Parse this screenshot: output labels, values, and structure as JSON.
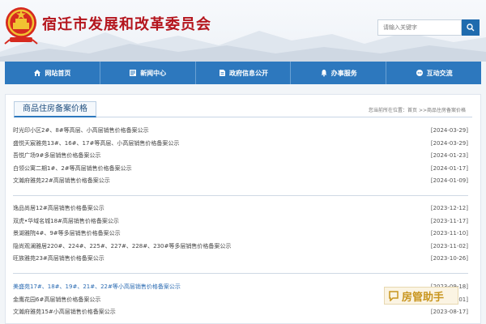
{
  "header": {
    "site_title": "宿迁市发展和改革委员会",
    "search_placeholder": "请输入关键字"
  },
  "nav": {
    "items": [
      {
        "label": "网站首页",
        "icon": "home-icon"
      },
      {
        "label": "新闻中心",
        "icon": "news-icon"
      },
      {
        "label": "政府信息公开",
        "icon": "document-icon"
      },
      {
        "label": "办事服务",
        "icon": "bell-icon"
      },
      {
        "label": "互动交流",
        "icon": "chat-icon"
      }
    ]
  },
  "section": {
    "title": "商品住房备案价格",
    "breadcrumb": "您当前所在位置：首页 >>商品住房备案价格"
  },
  "groups": [
    [
      {
        "title": "时光印小区2#、8#等高层、小高层销售价格备案公示",
        "date": "[2024-03-29]"
      },
      {
        "title": "盛悦天宸雅苑13#、16#、17#等高层、小高层销售价格备案公示",
        "date": "[2024-03-29]"
      },
      {
        "title": "吾悦广场9#多层销售价格备案公示",
        "date": "[2024-01-23]"
      },
      {
        "title": "白领公寓二期1#、2#等高层销售价格备案公示",
        "date": "[2024-01-17]"
      },
      {
        "title": "文瀚府雅苑22#高层销售价格备案公示",
        "date": "[2024-01-09]"
      }
    ],
    [
      {
        "title": "逸品尚居12#高层销售价格备案公示",
        "date": "[2023-12-12]"
      },
      {
        "title": "双虎•华域名城18#高层销售价格备案公示",
        "date": "[2023-11-17]"
      },
      {
        "title": "景湖雅院4#、9#等多层销售价格备案公示",
        "date": "[2023-11-10]"
      },
      {
        "title": "隐尚观澜雅居220#、224#、225#、227#、228#、230#等多层销售价格备案公示",
        "date": "[2023-11-02]"
      },
      {
        "title": "旺族雅苑23#高层销售价格备案公示",
        "date": "[2023-10-26]"
      }
    ],
    [
      {
        "title": "美盛苑17#、18#、19#、21#、22#等小高层销售价格备案公示",
        "date": "[2023-09-18]"
      },
      {
        "title": "金鹰花园6#高层销售价格备案公示",
        "date": "[2023-09-01]"
      },
      {
        "title": "文瀚府雅苑15#小高层销售价格备案公示",
        "date": "[2023-08-17]"
      }
    ]
  ],
  "watermark": {
    "text": "房管助手"
  },
  "colors": {
    "brand_red": "#b4151d",
    "nav_blue": "#2d78be",
    "link_highlight": "#2c6cb3",
    "watermark": "#c8951e"
  }
}
